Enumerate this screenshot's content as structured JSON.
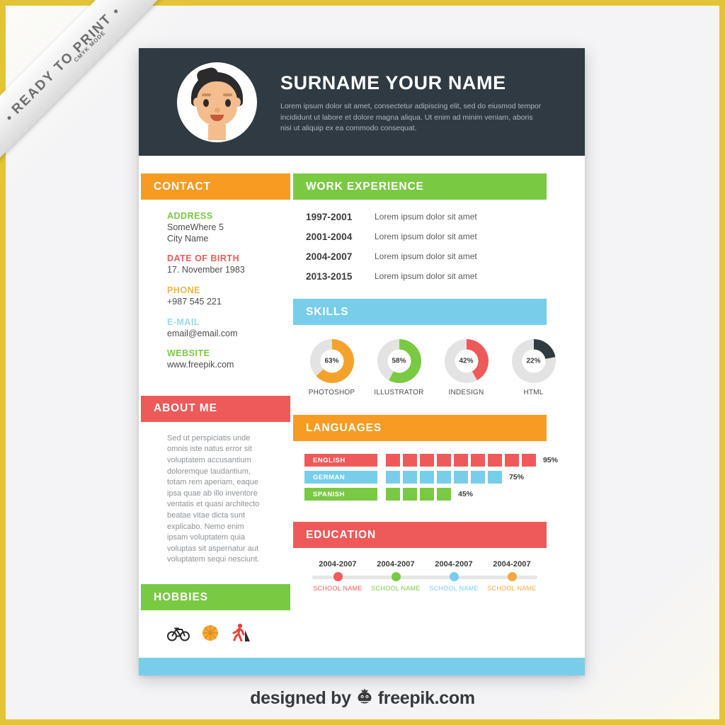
{
  "ribbon": {
    "main_text": "READY TO PRINT",
    "sub_text": "CMYK MODE"
  },
  "header": {
    "name": "SURNAME YOUR NAME",
    "summary": "Lorem ipsum dolor sit amet, consectetur adipiscing elit, sed do eiusmod tempor incididunt ut labore et dolore magna aliqua. Ut enim ad minim veniam,  aboris nisi ut aliquip ex ea commodo consequat.",
    "avatar_alt": "avatar",
    "background_color": "#2f3a42"
  },
  "contact": {
    "title": "CONTACT",
    "bar_color": "#f79b23",
    "items": [
      {
        "label": "ADDRESS",
        "label_color": "#7ac943",
        "value": "SomeWhere 5\nCity Name"
      },
      {
        "label": "DATE OF BIRTH",
        "label_color": "#ee5a5a",
        "value": "17. November 1983"
      },
      {
        "label": "PHONE",
        "label_color": "#f0b54a",
        "value": "+987 545 221"
      },
      {
        "label": "E-MAIL",
        "label_color": "#9ad9ef",
        "value": "email@email.com"
      },
      {
        "label": "WEBSITE",
        "label_color": "#7ac943",
        "value": "www.freepik.com"
      }
    ]
  },
  "about": {
    "title": "ABOUT ME",
    "bar_color": "#ee5a5a",
    "text": "Sed ut perspiciatis unde omnis iste natus error sit voluptatem accusantium doloremque laudantium, totam rem aperiam, eaque ipsa quae ab illo inventore ventatis et quasi architecto beatae vitae dicta sunt explicabo. Nemo enim ipsam voluptatem quia voluptas sit aspernatur aut voluptatem sequi nesciunt."
  },
  "hobbies": {
    "title": "HOBBIES",
    "bar_color": "#7ac943",
    "icons": [
      {
        "name": "bicycle-icon",
        "color": "#2b2b2e"
      },
      {
        "name": "basketball-icon",
        "color": "#f5a93c"
      },
      {
        "name": "hiking-icon",
        "color": "#e8453c"
      }
    ]
  },
  "work_experience": {
    "title": "WORK EXPERIENCE",
    "bar_color": "#7ac943",
    "rows": [
      {
        "years": "1997-2001",
        "description": "Lorem ipsum dolor sit amet"
      },
      {
        "years": "2001-2004",
        "description": "Lorem ipsum dolor sit amet"
      },
      {
        "years": "2004-2007",
        "description": "Lorem ipsum dolor sit amet"
      },
      {
        "years": "2013-2015",
        "description": "Lorem ipsum dolor sit amet"
      }
    ]
  },
  "skills": {
    "title": "SKILLS",
    "bar_color": "#78cdea"
  },
  "languages": {
    "title": "LANGUAGES",
    "bar_color": "#f79b23"
  },
  "education": {
    "title": "EDUCATION",
    "bar_color": "#ee5a5a",
    "entries": [
      {
        "years": "2004-2007",
        "school": "SCHOOL NAME",
        "color": "#ee5a5a"
      },
      {
        "years": "2004-2007",
        "school": "SCHOOL NAME",
        "color": "#7ac943"
      },
      {
        "years": "2004-2007",
        "school": "SCHOOL NAME",
        "color": "#78cdea"
      },
      {
        "years": "2004-2007",
        "school": "SCHOOL NAME",
        "color": "#f5a93c"
      }
    ]
  },
  "footer": {
    "prefix": "designed by",
    "brand": "freepik.com",
    "logo_name": "freepik-crown-logo"
  },
  "chart_data": [
    {
      "type": "pie",
      "title": "SKILLS",
      "chart_style": "donut-gauge",
      "categories": [
        "PHOTOSHOP",
        "ILLUSTRATOR",
        "INDESIGN",
        "HTML"
      ],
      "values": [
        63,
        58,
        42,
        22
      ],
      "value_labels": [
        "63%",
        "58%",
        "42%",
        "22%"
      ],
      "colors": [
        "#f5a22c",
        "#7ac943",
        "#ee5a5a",
        "#2f3a42"
      ],
      "track_color": "#e3e3e3",
      "ylim": [
        0,
        100
      ],
      "xlabel": "",
      "ylabel": "",
      "legend": "none"
    },
    {
      "type": "bar",
      "title": "LANGUAGES",
      "chart_style": "segmented-horizontal-bar",
      "categories": [
        "ENGLISH",
        "GERMAN",
        "SPANISH"
      ],
      "values": [
        95,
        75,
        45
      ],
      "value_labels": [
        "95%",
        "75%",
        "45%"
      ],
      "blocks": [
        9,
        7,
        4
      ],
      "blocks_max": 10,
      "colors": [
        "#ee5a5a",
        "#78cdea",
        "#7ac943"
      ],
      "xlabel": "",
      "ylabel": "",
      "xlim": [
        0,
        100
      ],
      "grid": false,
      "legend": "none"
    },
    {
      "type": "line",
      "title": "EDUCATION",
      "chart_style": "timeline",
      "categories": [
        "2004-2007",
        "2004-2007",
        "2004-2007",
        "2004-2007"
      ],
      "point_labels": [
        "SCHOOL NAME",
        "SCHOOL NAME",
        "SCHOOL NAME",
        "SCHOOL NAME"
      ],
      "colors": [
        "#ee5a5a",
        "#7ac943",
        "#78cdea",
        "#f5a93c"
      ],
      "axis_color": "#e6e6e6",
      "grid": false,
      "legend": "none"
    }
  ]
}
